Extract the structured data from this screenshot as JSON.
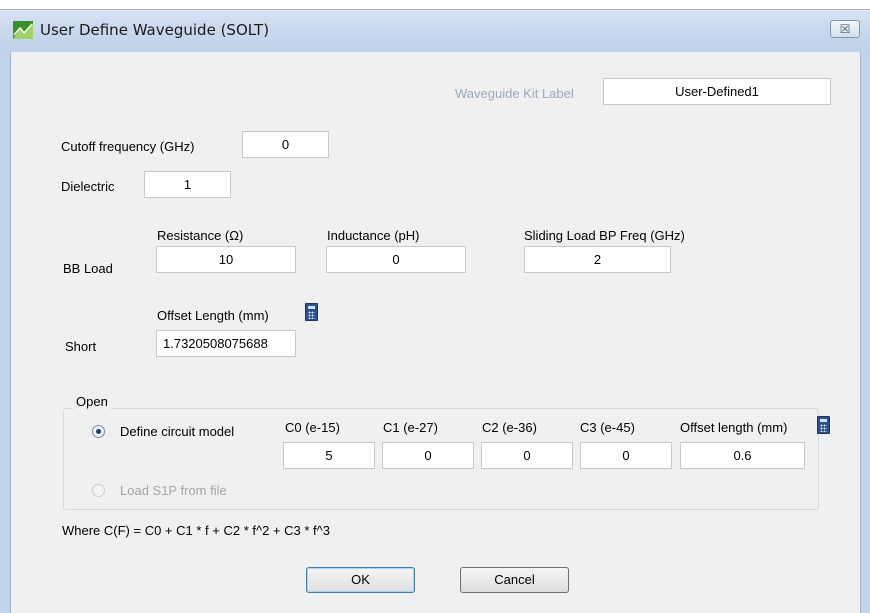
{
  "window": {
    "title": "User Define Waveguide (SOLT)",
    "close_glyph": "☒"
  },
  "kit": {
    "label": "Waveguide Kit Label",
    "value": "User-Defined1"
  },
  "cutoff": {
    "label": "Cutoff frequency (GHz)",
    "value": "0"
  },
  "dielectric": {
    "label": "Dielectric",
    "value": "1"
  },
  "bb_load": {
    "row_label": "BB Load",
    "resistance_label": "Resistance (Ω)",
    "resistance_value": "10",
    "inductance_label": "Inductance (pH)",
    "inductance_value": "0",
    "sliding_label": "Sliding Load BP Freq (GHz)",
    "sliding_value": "2"
  },
  "short": {
    "row_label": "Short",
    "offset_label": "Offset Length (mm)",
    "offset_value": "1.7320508075688"
  },
  "open": {
    "group_label": "Open",
    "define_circuit_label": "Define circuit model",
    "define_circuit_selected": true,
    "load_s1p_label": "Load S1P from file",
    "c0_label": "C0 (e-15)",
    "c0_value": "5",
    "c1_label": "C1 (e-27)",
    "c1_value": "0",
    "c2_label": "C2 (e-36)",
    "c2_value": "0",
    "c3_label": "C3 (e-45)",
    "c3_value": "0",
    "offset_label": "Offset length (mm)",
    "offset_value": "0.6"
  },
  "formula": "Where C(F) = C0 + C1 * f + C2 * f^2 + C3 * f^3",
  "buttons": {
    "ok": "OK",
    "cancel": "Cancel"
  },
  "icons": {
    "app": "waveguide-app-icon",
    "close": "close-icon",
    "calculator": "calculator-icon"
  },
  "colors": {
    "title_bar": "#c9d9ee",
    "disabled_text": "#9aa8c0",
    "default_button_border": "#3c7fb1"
  }
}
